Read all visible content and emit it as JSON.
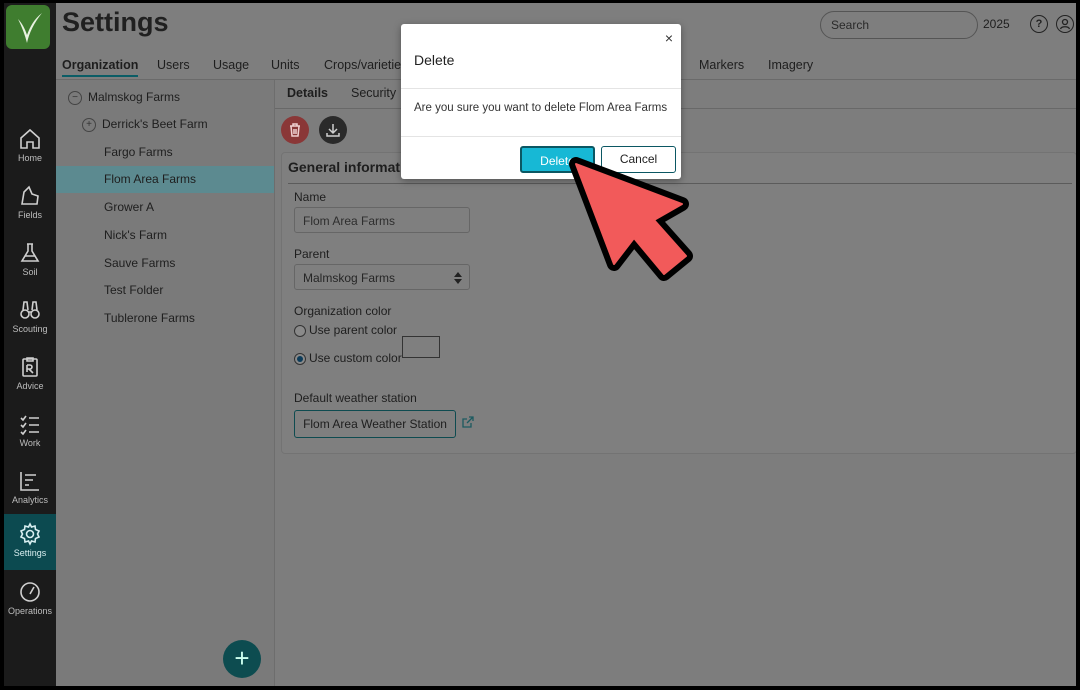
{
  "header": {
    "title": "Settings",
    "search_placeholder": "Search",
    "year": "2025",
    "help_icon": "question-circle-icon",
    "user_icon": "user-circle-icon"
  },
  "main_tabs": [
    "Organization",
    "Users",
    "Usage",
    "Units",
    "Crops/varietie",
    "Markers",
    "Imagery"
  ],
  "rail": {
    "items": [
      {
        "label": "Home",
        "icon": "home-icon"
      },
      {
        "label": "Fields",
        "icon": "field-icon"
      },
      {
        "label": "Soil",
        "icon": "flask-icon"
      },
      {
        "label": "Scouting",
        "icon": "binoculars-icon"
      },
      {
        "label": "Advice",
        "icon": "prescription-icon"
      },
      {
        "label": "Work",
        "icon": "checklist-icon"
      },
      {
        "label": "Analytics",
        "icon": "chart-icon"
      },
      {
        "label": "Settings",
        "icon": "gear-icon"
      },
      {
        "label": "Operations",
        "icon": "gauge-icon"
      }
    ]
  },
  "tree": {
    "items": [
      {
        "label": "Malmskog Farms",
        "toggle": "−"
      },
      {
        "label": "Derrick's Beet Farm",
        "toggle": "+"
      },
      {
        "label": "Fargo Farms"
      },
      {
        "label": "Flom Area Farms"
      },
      {
        "label": "Grower A"
      },
      {
        "label": "Nick's Farm"
      },
      {
        "label": "Sauve Farms"
      },
      {
        "label": "Test Folder"
      },
      {
        "label": "Tublerone Farms"
      }
    ],
    "add_button": "+"
  },
  "content": {
    "subtabs": [
      "Details",
      "Security"
    ],
    "section_title": "General informati",
    "name_label": "Name",
    "name_value": "Flom Area Farms",
    "parent_label": "Parent",
    "parent_value": "Malmskog Farms",
    "color_label": "Organization color",
    "use_parent": "Use parent color",
    "use_custom": "Use custom color",
    "weather_label": "Default weather station",
    "weather_value": "Flom Area Weather Station"
  },
  "dialog": {
    "title": "Delete",
    "close": "×",
    "message": "Are you sure you want to delete Flom Area Farms",
    "delete_label": "Delete",
    "cancel_label": "Cancel"
  }
}
